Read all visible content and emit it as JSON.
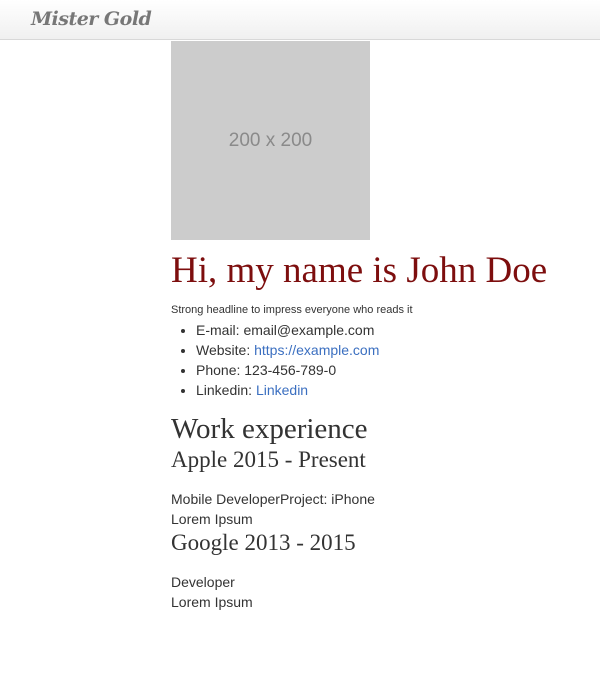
{
  "navbar": {
    "brand": "Mister Gold"
  },
  "profile": {
    "avatar_text": "200 x 200",
    "greeting": "Hi, my name is John Doe",
    "headline": "Strong headline to impress everyone who reads it",
    "contacts": [
      {
        "label": "E-mail:",
        "value": "email@example.com"
      },
      {
        "label": "Website:",
        "value": "https://example.com"
      },
      {
        "label": "Phone:",
        "value": "123-456-789-0"
      },
      {
        "label": "Linkedin:",
        "value": "Linkedin"
      }
    ]
  },
  "experience": {
    "title": "Work experience",
    "jobs": [
      {
        "heading": "Apple 2015 - Present",
        "line1": "Mobile DeveloperProject: iPhone",
        "line2": "Lorem Ipsum"
      },
      {
        "heading": "Google 2013 - 2015",
        "line1": "Developer",
        "line2": "Lorem Ipsum"
      }
    ]
  },
  "colors": {
    "link": "#3b6fc0",
    "heading_accent": "#7d0e0e",
    "placeholder_bg": "#cccccc"
  }
}
